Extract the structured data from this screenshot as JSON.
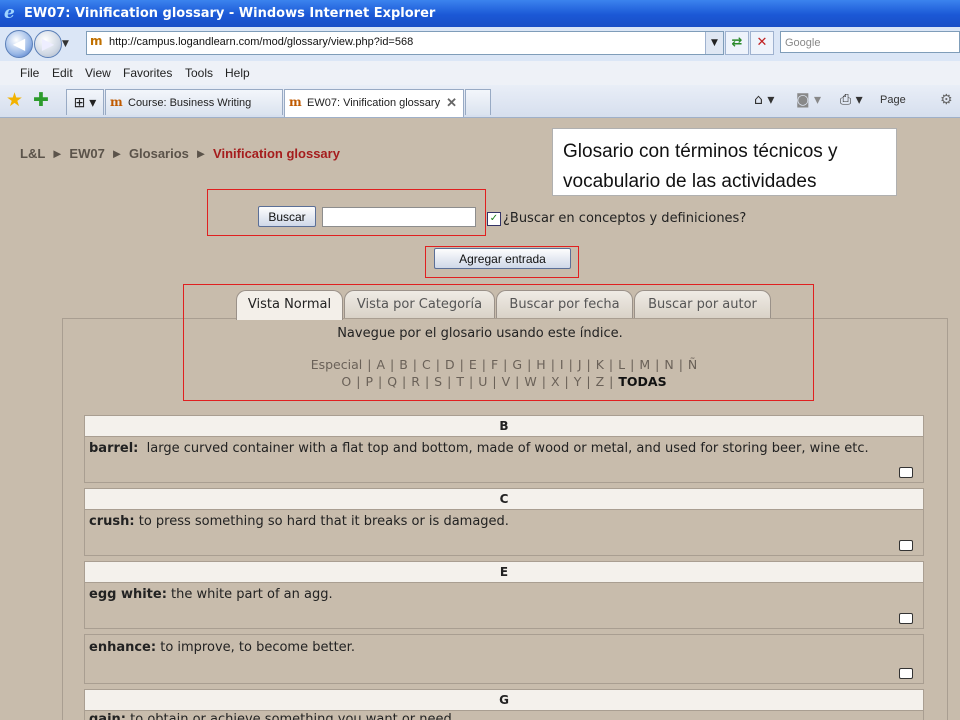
{
  "window": {
    "title": "EW07: Vinification glossary - Windows Internet Explorer"
  },
  "address": {
    "url": "http://campus.logandlearn.com/mod/glossary/view.php?id=568",
    "search_placeholder": "Google"
  },
  "menu": [
    "File",
    "Edit",
    "View",
    "Favorites",
    "Tools",
    "Help"
  ],
  "browser_tabs": [
    {
      "label": "Course: Business Writing"
    },
    {
      "label": "EW07: Vinification glossary"
    }
  ],
  "toolbar": {
    "page_label": "Page"
  },
  "breadcrumb": {
    "items": [
      "L&L",
      "►",
      "EW07",
      "►",
      "Glosarios",
      "►"
    ],
    "current": "Vinification glossary"
  },
  "callout": {
    "line1": "Glosario con términos técnicos y",
    "line2": "vocabulario de las actividades"
  },
  "search": {
    "button": "Buscar",
    "value": "",
    "checkbox_label": "¿Buscar en conceptos y definiciones?",
    "checked": true
  },
  "add_entry": {
    "label": "Agregar entrada"
  },
  "view_tabs": [
    {
      "label": "Vista Normal",
      "active": true
    },
    {
      "label": "Vista por Categoría"
    },
    {
      "label": "Buscar por fecha"
    },
    {
      "label": "Buscar por autor"
    }
  ],
  "index": {
    "title": "Navegue por el glosario usando este índice.",
    "row1": [
      "Especial",
      "A",
      "B",
      "C",
      "D",
      "E",
      "F",
      "G",
      "H",
      "I",
      "J",
      "K",
      "L",
      "M",
      "N",
      "Ñ"
    ],
    "row2": [
      "O",
      "P",
      "Q",
      "R",
      "S",
      "T",
      "U",
      "V",
      "W",
      "X",
      "Y",
      "Z",
      "TODAS"
    ]
  },
  "entries": [
    {
      "heading": "B",
      "term": "barrel:",
      "definition": "large curved container with a flat top and bottom, made of wood or metal, and used for storing beer, wine etc."
    },
    {
      "heading": "C",
      "term": "crush:",
      "definition": "to press something so hard that it breaks or is damaged."
    },
    {
      "heading": "E",
      "term": "egg white:",
      "definition": "the white part of an agg."
    },
    {
      "heading": "",
      "term": "enhance:",
      "definition": "to improve, to become better."
    },
    {
      "heading": "G",
      "term": "gain:",
      "definition": "to obtain or achieve something you want or need."
    }
  ]
}
